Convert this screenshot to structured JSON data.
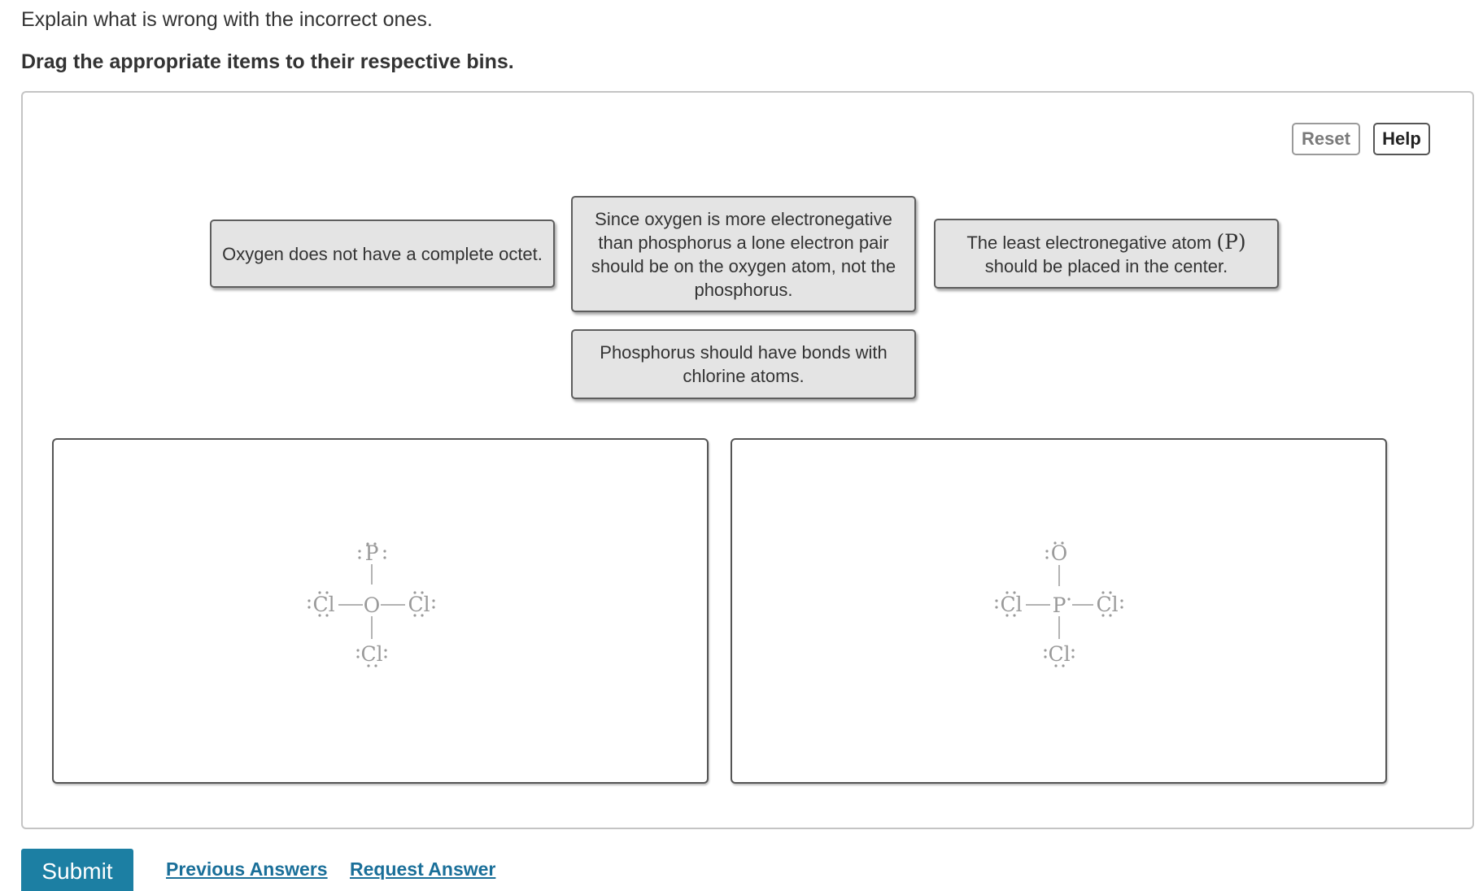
{
  "instruction": "Explain what is wrong with the incorrect ones.",
  "subinstruction": "Drag the appropriate items to their respective bins.",
  "toolbar": {
    "reset_label": "Reset",
    "help_label": "Help"
  },
  "items": [
    {
      "text": "Oxygen does not have a complete octet."
    },
    {
      "text": "Since oxygen is more electronegative than phosphorus a lone electron pair should be on the oxygen atom, not the phosphorus."
    },
    {
      "text_before": "The least electronegative atom ",
      "symbol": "(P)",
      "text_after": " should be placed in the center."
    },
    {
      "text": "Phosphorus should have bonds with chlorine atoms."
    }
  ],
  "bins": [
    {
      "structure": {
        "top": "P",
        "center": "O",
        "left": "Cl",
        "right": "Cl",
        "bottom": "Cl"
      }
    },
    {
      "structure": {
        "top": "O",
        "center": "P",
        "left": "Cl",
        "right": "Cl",
        "bottom": "Cl"
      }
    }
  ],
  "actions": {
    "submit_label": "Submit",
    "previous_answers_label": "Previous Answers",
    "request_answer_label": "Request Answer"
  },
  "colors": {
    "submit_bg": "#1c7fa3",
    "link": "#1a6f99",
    "chip_bg": "#e4e4e4",
    "structure_gray": "#9a9a9a"
  }
}
